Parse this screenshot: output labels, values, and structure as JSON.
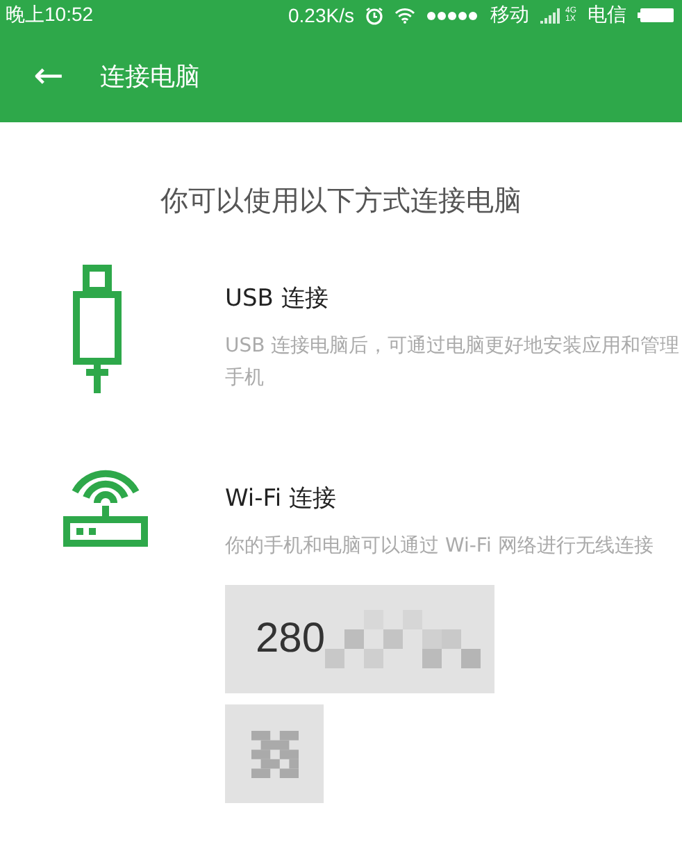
{
  "status_bar": {
    "time": "晚上10:52",
    "speed": "0.23K/s",
    "carrier_1": "移动",
    "network_type": [
      "4G",
      "1X"
    ],
    "carrier_2": "电信"
  },
  "header": {
    "back_icon": "←",
    "title": "连接电脑"
  },
  "heading": "你可以使用以下方式连接电脑",
  "methods": [
    {
      "kind": "usb",
      "title": "USB 连接",
      "description": "USB 连接电脑后，可通过电脑更好地安装应用和管理手机"
    },
    {
      "kind": "wifi",
      "title": "Wi-Fi 连接",
      "description": "你的手机和电脑可以通过 Wi-Fi 网络进行无线连接"
    }
  ],
  "code": {
    "value": "280"
  }
}
